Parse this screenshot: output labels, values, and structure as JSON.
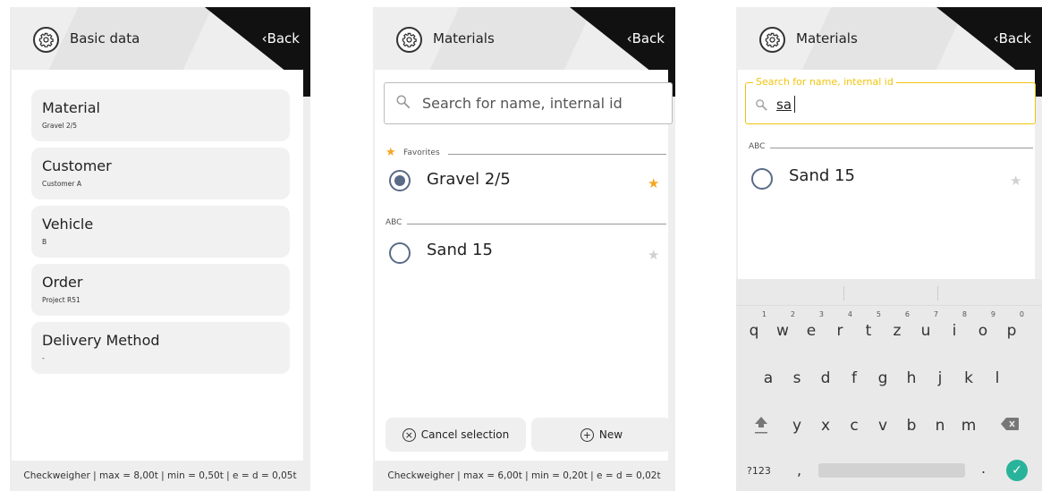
{
  "screens": [
    {
      "title": "Basic data",
      "back_label": "Back",
      "fields": [
        {
          "label": "Material",
          "value": "Gravel 2/5"
        },
        {
          "label": "Customer",
          "value": "Customer A"
        },
        {
          "label": "Vehicle",
          "value": "B"
        },
        {
          "label": "Order",
          "value": "Project R51"
        },
        {
          "label": "Delivery Method",
          "value": "-"
        }
      ],
      "footer": "Checkweigher | max = 8,00t | min = 0,50t | e = d = 0,05t"
    },
    {
      "title": "Materials",
      "back_label": "Back",
      "search_placeholder": "Search for name, internal id",
      "favorites_header": "Favorites",
      "favorite_item": "Gravel 2/5",
      "abc_header": "ABC",
      "abc_item": "Sand 15",
      "cancel_label": "Cancel selection",
      "new_label": "New",
      "footer": "Checkweigher | max = 6,00t | min = 0,20t | e = d = 0,02t"
    },
    {
      "title": "Materials",
      "back_label": "Back",
      "search_label": "Search for name, internal id",
      "search_value": "sa",
      "abc_header": "ABC",
      "abc_item": "Sand 15",
      "keyboard": {
        "row1": [
          "q",
          "w",
          "e",
          "r",
          "t",
          "z",
          "u",
          "i",
          "o",
          "p"
        ],
        "row1_nums": [
          "1",
          "2",
          "3",
          "4",
          "5",
          "6",
          "7",
          "8",
          "9",
          "0"
        ],
        "row2": [
          "a",
          "s",
          "d",
          "f",
          "g",
          "h",
          "j",
          "k",
          "l"
        ],
        "row3": [
          "y",
          "x",
          "c",
          "v",
          "b",
          "n",
          "m"
        ],
        "symbols_key": "?123",
        "comma_key": ",",
        "period_key": "."
      }
    }
  ],
  "colors": {
    "accent_yellow": "#f1c40f",
    "star_orange": "#f5a623",
    "radio_blue": "#5a6b86",
    "enter_green": "#29b39a"
  }
}
